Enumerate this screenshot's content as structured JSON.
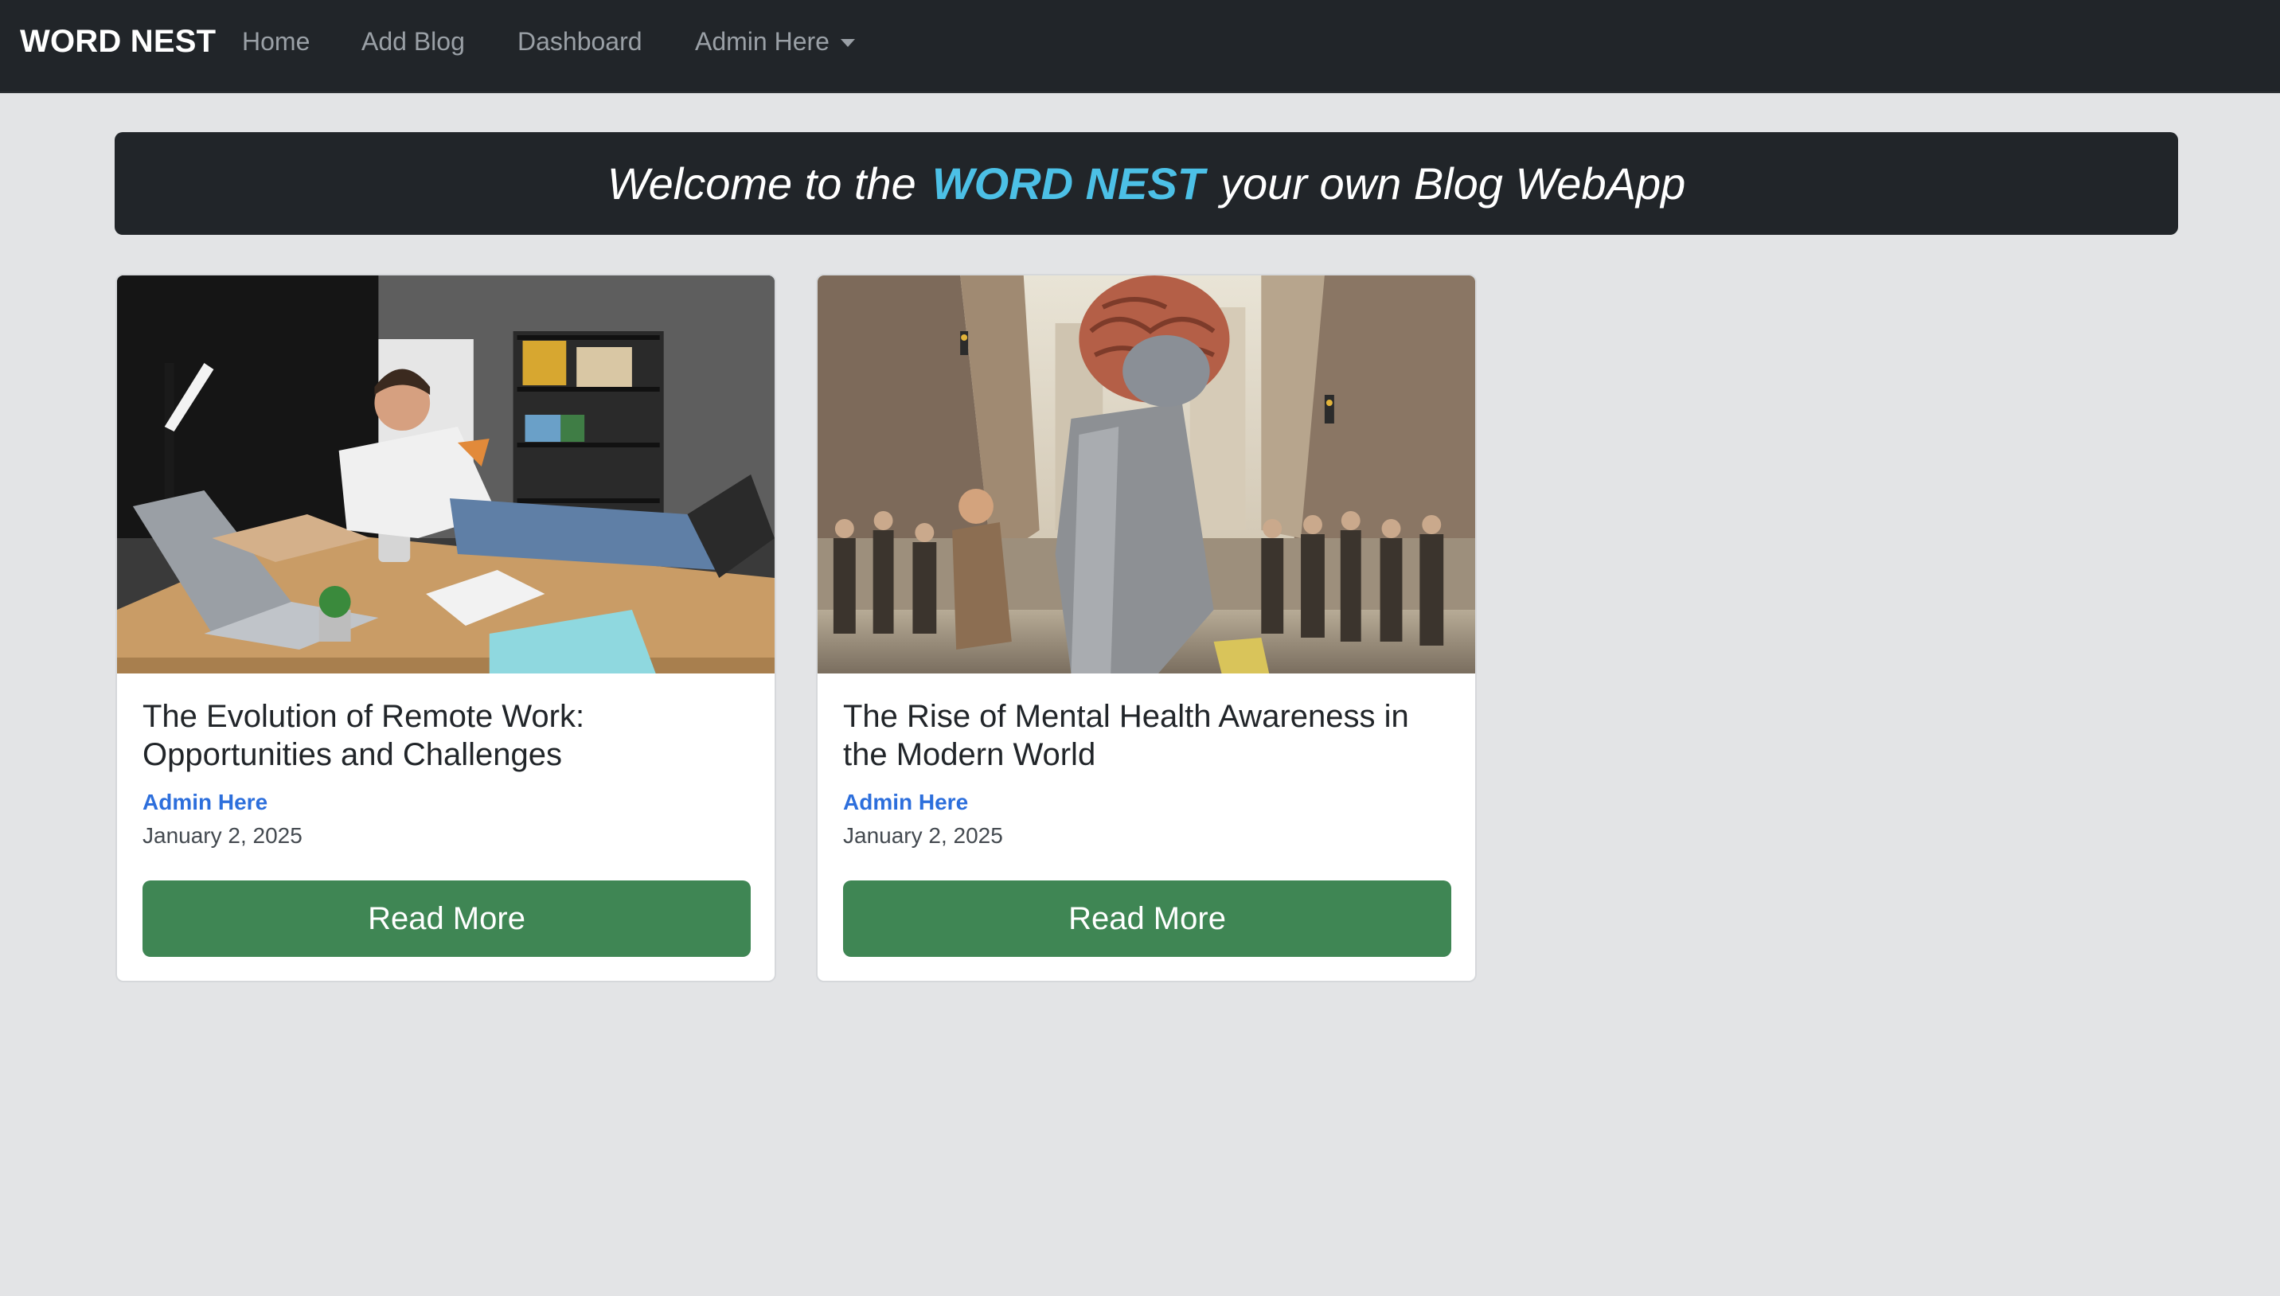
{
  "navbar": {
    "brand": "WORD NEST",
    "items": [
      {
        "label": "Home"
      },
      {
        "label": "Add Blog"
      },
      {
        "label": "Dashboard"
      }
    ],
    "admin_dropdown": "Admin Here"
  },
  "hero": {
    "prefix": "Welcome to the",
    "brand": "WORD NEST",
    "suffix": "your own Blog WebApp"
  },
  "posts": [
    {
      "title": "The Evolution of Remote Work: Opportunities and Challenges",
      "author": "Admin Here",
      "date": "January 2, 2025",
      "button": "Read More",
      "image": "photo-remote-worker-at-desk"
    },
    {
      "title": "The Rise of Mental Health Awareness in the Modern World",
      "author": "Admin Here",
      "date": "January 2, 2025",
      "button": "Read More",
      "image": "illustration-brain-head-in-city-crowd"
    }
  ],
  "colors": {
    "navbar_bg": "#212529",
    "page_bg": "#e3e4e6",
    "brand_accent": "#4cc0e6",
    "author_link": "#2d6fdc",
    "button_bg": "#3f8654"
  }
}
